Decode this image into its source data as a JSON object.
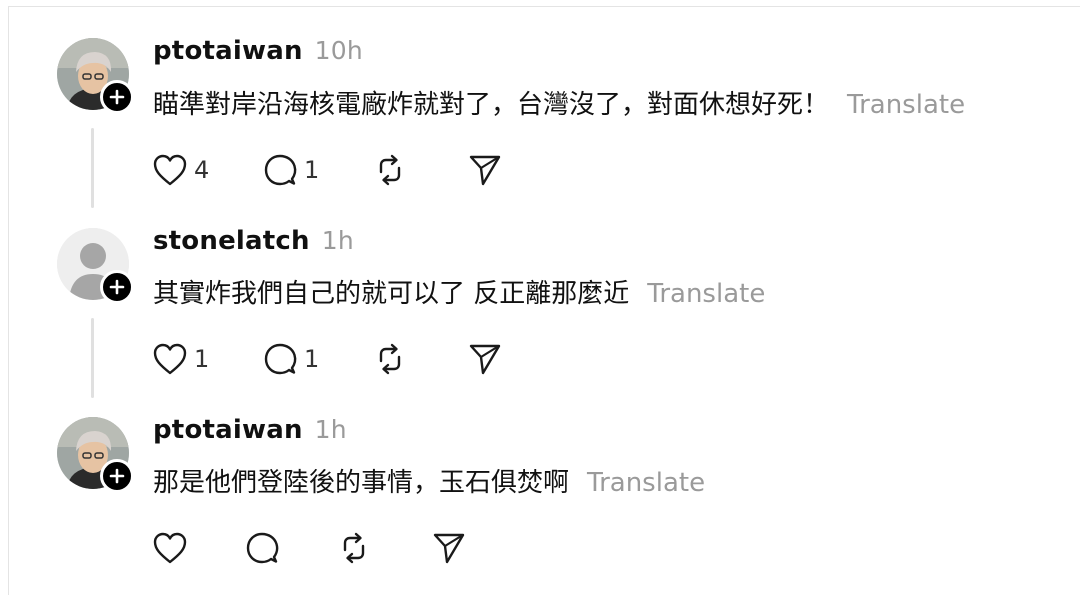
{
  "posts": [
    {
      "username": "ptotaiwan",
      "time": "10h",
      "text": "瞄準對岸沿海核電廠炸就對了，台灣沒了，對面休想好死！",
      "translate_label": "Translate",
      "avatar": "photo",
      "likes": "4",
      "replies": "1",
      "reposts": "",
      "shares": ""
    },
    {
      "username": "stonelatch",
      "time": "1h",
      "text": "其實炸我們自己的就可以了 反正離那麼近",
      "translate_label": "Translate",
      "avatar": "default",
      "likes": "1",
      "replies": "1",
      "reposts": "",
      "shares": ""
    },
    {
      "username": "ptotaiwan",
      "time": "1h",
      "text": "那是他們登陸後的事情，玉石俱焚啊",
      "translate_label": "Translate",
      "avatar": "photo",
      "likes": "",
      "replies": "",
      "reposts": "",
      "shares": ""
    }
  ],
  "icons": {
    "like": "heart-icon",
    "reply": "comment-icon",
    "repost": "repost-icon",
    "share": "send-icon",
    "follow": "plus-icon"
  },
  "colors": {
    "text": "#111111",
    "muted": "#9a9a9a",
    "thread_line": "#e0e0e0",
    "badge": "#000000"
  }
}
